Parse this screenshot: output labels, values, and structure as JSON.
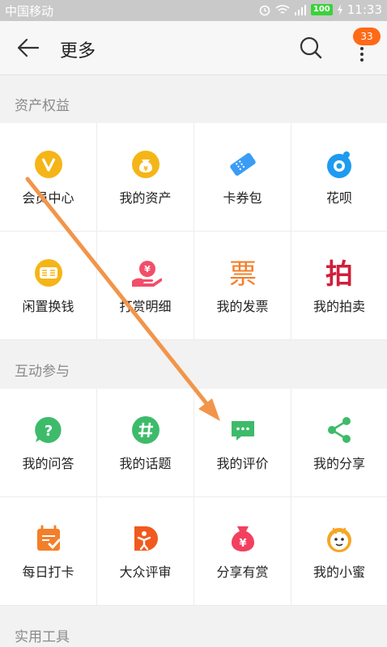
{
  "status": {
    "carrier": "中国移动",
    "battery": "100",
    "time": "11:33"
  },
  "header": {
    "title": "更多",
    "badge": "33"
  },
  "sections": [
    {
      "title": "资产权益",
      "items": [
        {
          "label": "会员中心",
          "icon": "member-center-icon"
        },
        {
          "label": "我的资产",
          "icon": "money-bag-icon"
        },
        {
          "label": "卡券包",
          "icon": "ticket-icon"
        },
        {
          "label": "花呗",
          "icon": "huabei-icon"
        },
        {
          "label": "闲置换钱",
          "icon": "idle-exchange-icon"
        },
        {
          "label": "打赏明细",
          "icon": "reward-detail-icon"
        },
        {
          "label": "我的发票",
          "icon": "invoice-icon",
          "glyph": "票"
        },
        {
          "label": "我的拍卖",
          "icon": "auction-icon",
          "glyph": "拍"
        }
      ]
    },
    {
      "title": "互动参与",
      "items": [
        {
          "label": "我的问答",
          "icon": "question-icon"
        },
        {
          "label": "我的话题",
          "icon": "hashtag-icon"
        },
        {
          "label": "我的评价",
          "icon": "comment-icon"
        },
        {
          "label": "我的分享",
          "icon": "share-icon"
        },
        {
          "label": "每日打卡",
          "icon": "calendar-check-icon"
        },
        {
          "label": "大众评审",
          "icon": "public-review-icon"
        },
        {
          "label": "分享有赏",
          "icon": "reward-bag-icon"
        },
        {
          "label": "我的小蜜",
          "icon": "assistant-icon"
        }
      ]
    },
    {
      "title": "实用工具",
      "items": []
    }
  ]
}
